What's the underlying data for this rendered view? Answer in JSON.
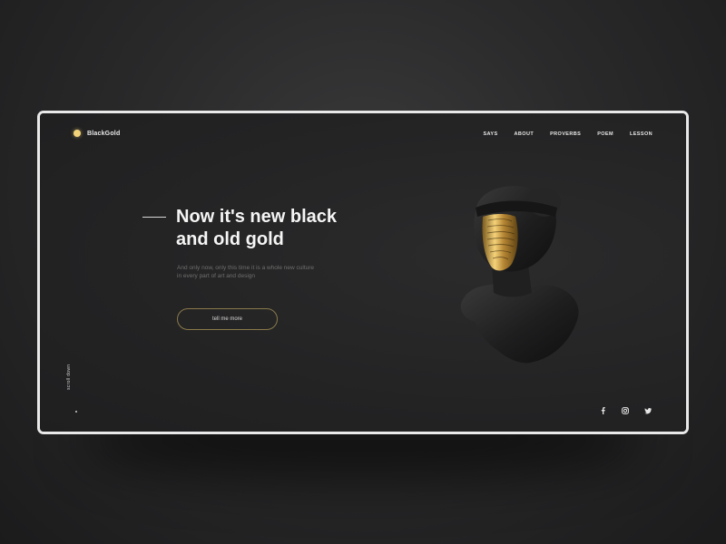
{
  "brand": {
    "name": "BlackGold",
    "accent_color": "#f3d37a"
  },
  "nav": {
    "items": [
      {
        "label": "SAYS"
      },
      {
        "label": "ABOUT"
      },
      {
        "label": "PROVERBS"
      },
      {
        "label": "POEM"
      },
      {
        "label": "LESSON"
      }
    ]
  },
  "hero": {
    "title_line1": "Now it's new black",
    "title_line2": "and old gold",
    "desc_line1": "And only now, only this time it is a whole new culture",
    "desc_line2": "in every part of art and design",
    "cta_label": "tell me more"
  },
  "scroll": {
    "label": "scroll down"
  },
  "social": {
    "icons": [
      "facebook-icon",
      "instagram-icon",
      "twitter-icon"
    ]
  },
  "image": {
    "name": "statue-bust-gold-mask",
    "mask_color": "#d4a84a"
  }
}
